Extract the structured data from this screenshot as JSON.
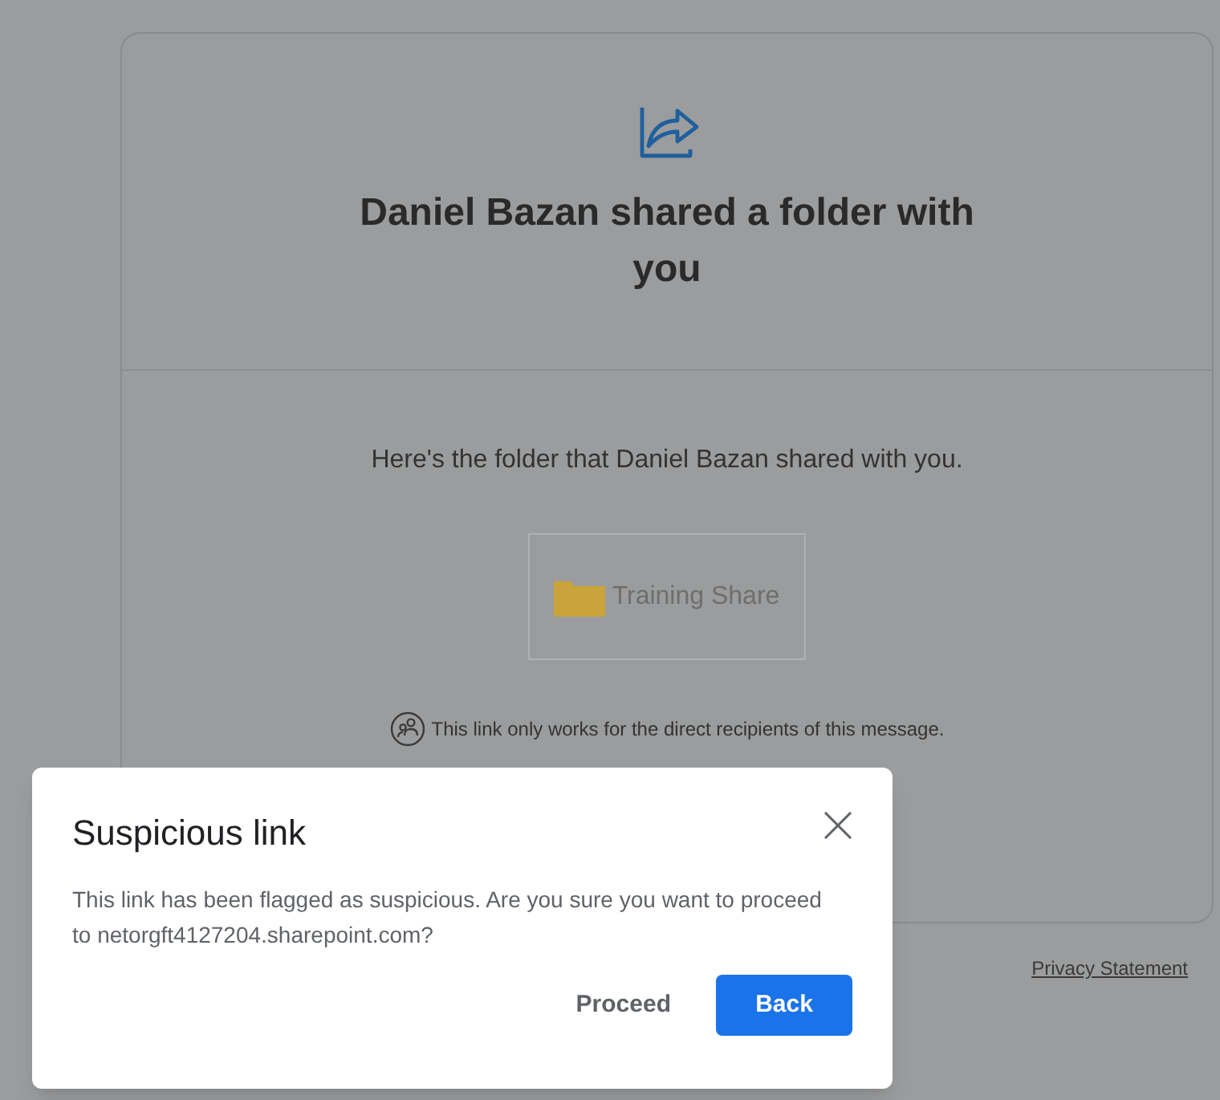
{
  "card": {
    "title": "Daniel Bazan shared a folder with you",
    "message": "Here's the folder that Daniel Bazan shared with you.",
    "folder": {
      "name": "Training Share"
    },
    "note": "This link only works for the direct recipients of this message."
  },
  "footer": {
    "link": "Privacy Statement"
  },
  "dialog": {
    "title": "Suspicious link",
    "body": "This link has been flagged as suspicious. Are you sure you want to proceed to netorgft4127204.sharepoint.com?",
    "buttons": [
      {
        "label": "Proceed",
        "kind": "text"
      },
      {
        "label": "Back",
        "kind": "primary"
      }
    ]
  }
}
